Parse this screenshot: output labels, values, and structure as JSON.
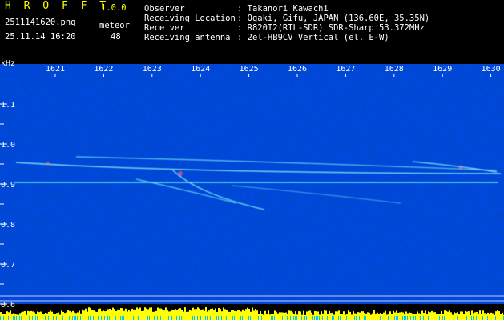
{
  "app": {
    "name": "H R O F F T",
    "version": "1.0.0"
  },
  "file": {
    "name": "2511141620.png",
    "datetime": "25.11.14 16:20"
  },
  "meteor": {
    "label": "meteor",
    "count": "48"
  },
  "info": {
    "observer": {
      "label": "Observer",
      "value": ": Takanori Kawachi"
    },
    "location": {
      "label": "Receiving Location",
      "value": ": Ogaki, Gifu, JAPAN (136.60E, 35.35N)"
    },
    "receiver": {
      "label": "Receiver",
      "value": ": R820T2(RTL-SDR) SDR-Sharp 53.372MHz"
    },
    "antenna": {
      "label": "Receiving antenna",
      "value": ": 2el-HB9CV Vertical (el. E-W)"
    }
  },
  "axes": {
    "y_unit": "kHz",
    "y_ticks": [
      "1.1",
      "1.0",
      "0.9",
      "0.8",
      "0.7",
      "0.6"
    ],
    "x_ticks": [
      "1621",
      "1622",
      "1623",
      "1624",
      "1625",
      "1626",
      "1627",
      "1628",
      "1629",
      "1630"
    ]
  },
  "colors": {
    "bg": "#000000",
    "noise": "#0a0a6e",
    "text": "#ffffff",
    "accent": "#ffff00",
    "echo": "#7fffff"
  }
}
